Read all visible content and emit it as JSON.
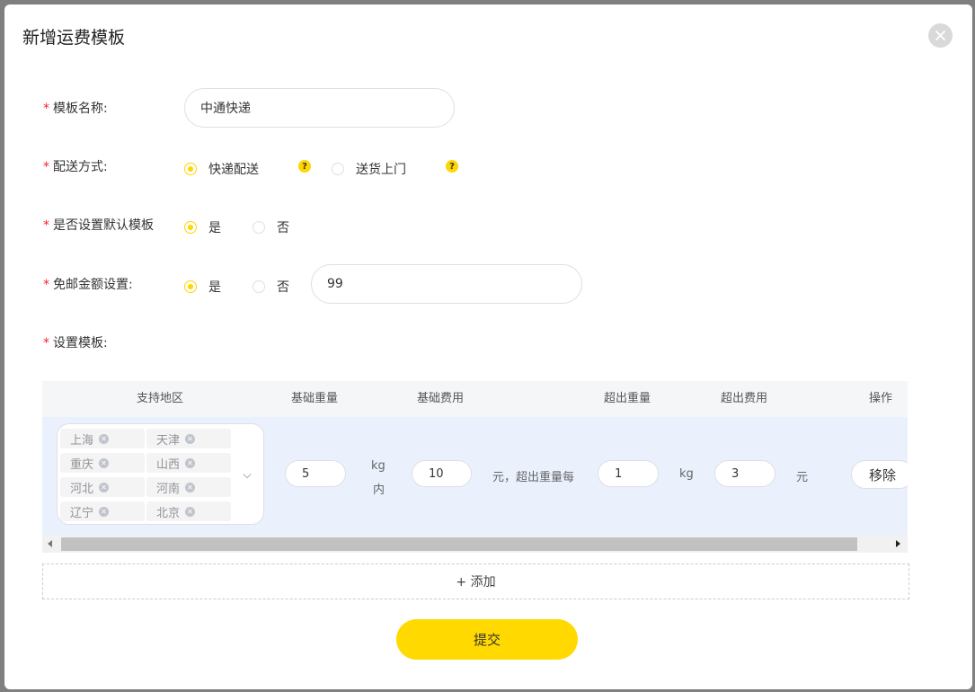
{
  "dialog": {
    "title": "新增运费模板",
    "close_icon": "close-icon"
  },
  "form": {
    "template_name": {
      "label": "模板名称:",
      "value": "中通快递"
    },
    "delivery_method": {
      "label": "配送方式:",
      "options": [
        "快递配送",
        "送货上门"
      ],
      "selected": "快递配送",
      "help_icon": "question-icon",
      "help_glyph": "?"
    },
    "default_template": {
      "label": "是否设置默认模板",
      "options": [
        "是",
        "否"
      ],
      "selected": "是"
    },
    "free_shipping": {
      "label": "免邮金额设置:",
      "options": [
        "是",
        "否"
      ],
      "selected": "是",
      "amount": "99"
    },
    "set_template": {
      "label": "设置模板:"
    },
    "required_mark": "*"
  },
  "table": {
    "headers": [
      "支持地区",
      "基础重量",
      "基础费用",
      "超出重量",
      "超出费用",
      "操作"
    ],
    "rows": [
      {
        "regions": [
          "上海",
          "天津",
          "重庆",
          "山西",
          "河北",
          "河南",
          "辽宁",
          "北京"
        ],
        "base_weight": "5",
        "base_weight_unit_1": "kg",
        "base_weight_unit_2": "内",
        "base_fee": "10",
        "base_fee_suffix": "元，超出重量每",
        "extra_weight": "1",
        "extra_weight_unit": "kg",
        "extra_fee": "3",
        "extra_fee_unit": "元",
        "remove_label": "移除"
      }
    ]
  },
  "actions": {
    "add_label": "+ 添加",
    "submit_label": "提交"
  },
  "colors": {
    "accent": "#ffd900",
    "required": "#f5222d",
    "row_highlight": "#eaf1fd"
  }
}
